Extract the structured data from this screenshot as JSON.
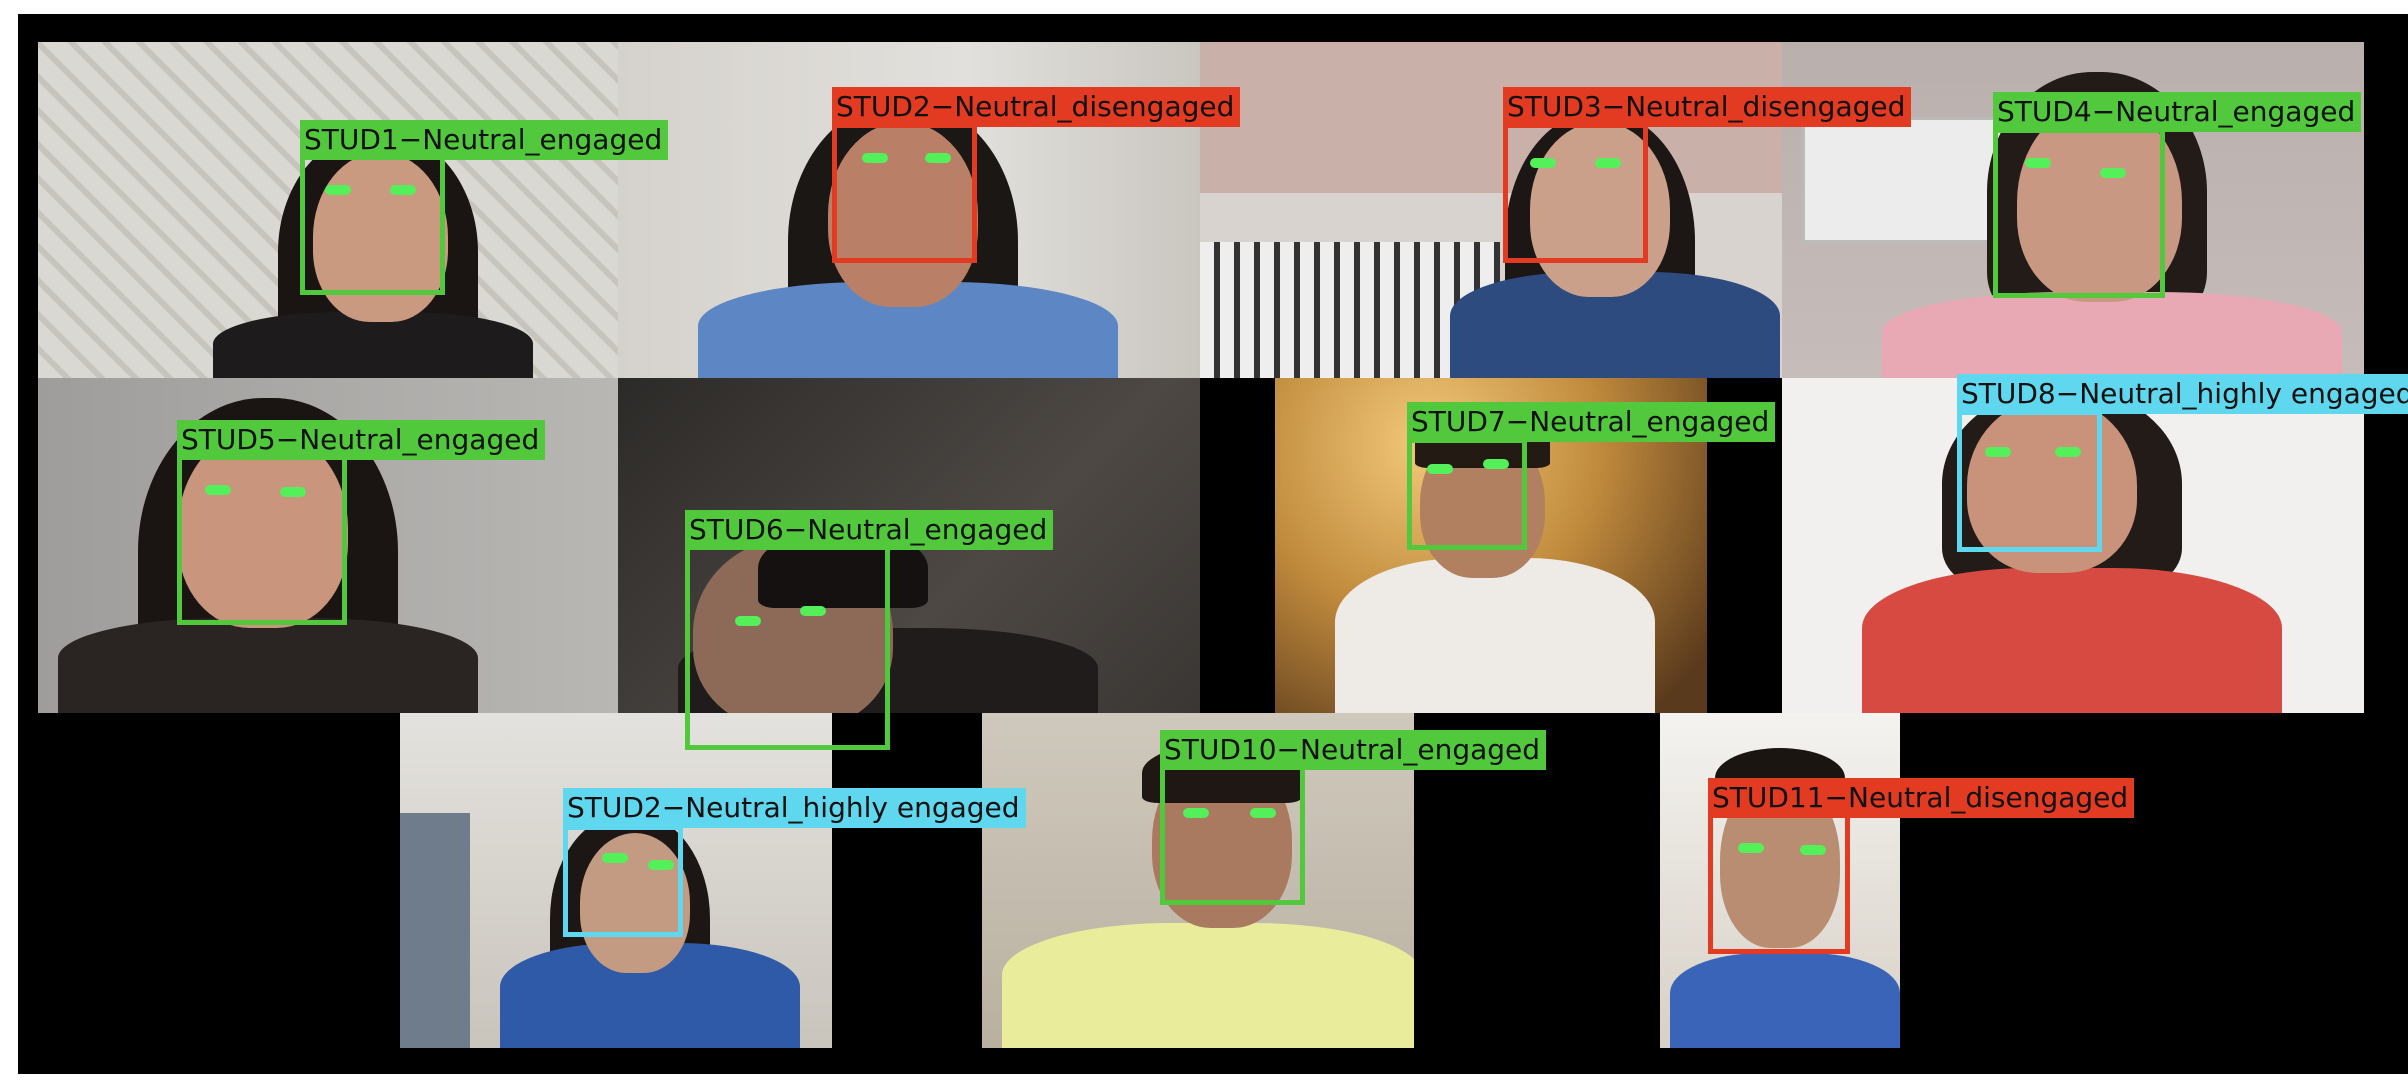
{
  "colors": {
    "engaged": "#52c93c",
    "disengaged": "#e33a22",
    "highly_engaged": "#5fd7ee",
    "eye_marker": "#54f05a",
    "background": "#000000"
  },
  "tiles": [
    {
      "label": "STUD1−Neutral_engaged",
      "status": "engaged"
    },
    {
      "label": "STUD2−Neutral_disengaged",
      "status": "disengaged"
    },
    {
      "label": "STUD3−Neutral_disengaged",
      "status": "disengaged"
    },
    {
      "label": "STUD4−Neutral_engaged",
      "status": "engaged"
    },
    {
      "label": "STUD5−Neutral_engaged",
      "status": "engaged"
    },
    {
      "label": "STUD6−Neutral_engaged",
      "status": "engaged"
    },
    {
      "label": "STUD7−Neutral_engaged",
      "status": "engaged"
    },
    {
      "label": "STUD8−Neutral_highly engaged",
      "status": "highly_engaged"
    },
    {
      "label": "STUD2−Neutral_highly engaged",
      "status": "highly_engaged"
    },
    {
      "label": "STUD10−Neutral_engaged",
      "status": "engaged"
    },
    {
      "label": "STUD11−Neutral_disengaged",
      "status": "disengaged"
    }
  ]
}
